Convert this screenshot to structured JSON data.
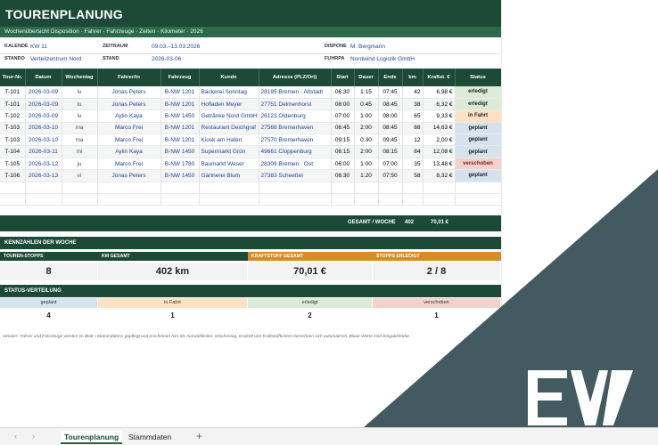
{
  "header": {
    "title": "TOURENPLANUNG",
    "subtitle": "Wochenübersicht Disposition · Fahrer · Fahrzeuge · Zeiten · Kilometer · 2026"
  },
  "meta": {
    "kalender_label": "KALENDE",
    "kalender_value": "KW 11",
    "zeitraum_label": "ZEITRAUM",
    "zeitraum_value": "09.03.–13.03.2026",
    "dispo_label": "DISPONE",
    "dispo_value": "M. Bergmann",
    "standort_label": "STANDO",
    "standort_value": "Verteilzentrum Nord",
    "stand_label": "STAND",
    "stand_value": "2026-03-06",
    "fuhrpark_label": "FUHRPA",
    "fuhrpark_value": "Nordwind Logistik GmbH"
  },
  "columns": [
    "Tour-Nr.",
    "Datum",
    "Wochentag",
    "Fahrer/in",
    "Fahrzeug",
    "Kunde",
    "Adresse (PLZ/Ort)",
    "Start",
    "Dauer",
    "Ende",
    "km",
    "Kraftst. €",
    "Status"
  ],
  "rows": [
    [
      "T-101",
      "2026-03-09",
      "lu",
      "Jonas Peters",
      "B-NW 1201",
      "Bäckerei Sonntag",
      "28195 Bremen · Altstadt",
      "06:30",
      "1:15",
      "07:45",
      "42",
      "6,98 €",
      "erledigt"
    ],
    [
      "T-101",
      "2026-03-09",
      "lu",
      "Jonas Peters",
      "B-NW 1201",
      "Hofladen Meyer",
      "27751 Delmenhorst",
      "08:00",
      "0:45",
      "08:45",
      "38",
      "6,32 €",
      "erledigt"
    ],
    [
      "T-102",
      "2026-03-09",
      "lu",
      "Aylin Kaya",
      "B-NW 1450",
      "Getränke Nord GmbH",
      "26123 Oldenburg",
      "07:00",
      "1:00",
      "08:00",
      "65",
      "9,33 €",
      "in Fahrt"
    ],
    [
      "T-103",
      "2026-03-10",
      "ma",
      "Marco Frei",
      "B-NW 1201",
      "Restaurant Deichgraf",
      "27568 Bremerhaven",
      "06:45",
      "2:00",
      "08:45",
      "88",
      "14,63 €",
      "geplant"
    ],
    [
      "T-103",
      "2026-03-10",
      "ma",
      "Marco Frei",
      "B-NW 1201",
      "Kiosk am Hafen",
      "27570 Bremerhaven",
      "09:15",
      "0:30",
      "09:45",
      "12",
      "2,00 €",
      "geplant"
    ],
    [
      "T-104",
      "2026-03-11",
      "mi",
      "Aylin Kaya",
      "B-NW 1450",
      "Supermarkt Grün",
      "49661 Cloppenburg",
      "06:15",
      "2:00",
      "08:15",
      "84",
      "12,08 €",
      "geplant"
    ],
    [
      "T-105",
      "2026-03-12",
      "ju",
      "Marco Frei",
      "B-NW 1780",
      "Baumarkt Weser",
      "28309 Bremen · Ost",
      "06:00",
      "1:00",
      "07:00",
      "35",
      "13,48 €",
      "verschoben"
    ],
    [
      "T-106",
      "2026-03-13",
      "vi",
      "Jonas Peters",
      "B-NW 1450",
      "Gärtnerei Blum",
      "27383 Scheeßel",
      "06:30",
      "1:20",
      "07:50",
      "58",
      "8,32 €",
      "geplant"
    ]
  ],
  "totals": {
    "label": "GESAMT / WOCHE",
    "km": "402",
    "fuel": "70,01 €"
  },
  "kpi": {
    "section_title": "KENNZAHLEN DER WOCHE",
    "items": [
      {
        "label": "TOUREN-STOPPS",
        "value": "8",
        "color": "#1d4a36"
      },
      {
        "label": "KM GESAMT",
        "value": "402 km",
        "color": "#1d4a36"
      },
      {
        "label": "KRAFTSTOFF GESAMT",
        "value": "70,01 €",
        "color": "#d98a2b"
      },
      {
        "label": "STOPPS ERLEDIGT",
        "value": "2 / 8",
        "color": "#d98a2b"
      }
    ]
  },
  "status_dist": {
    "section_title": "STATUS-VERTEILUNG",
    "items": [
      {
        "label": "geplant",
        "value": "4",
        "color": "#d6e3ef"
      },
      {
        "label": "in Fahrt",
        "value": "1",
        "color": "#fbe3c2"
      },
      {
        "label": "erledigt",
        "value": "2",
        "color": "#dcebd9"
      },
      {
        "label": "verschoben",
        "value": "1",
        "color": "#f4d2cc"
      }
    ]
  },
  "hint": "Hinweis: Fahrer und Fahrzeuge werden im Blatt »Stammdaten« gepflegt und erscheinen hier als Auswahllisten. Wochentag, Endzeit und Kraftstoffkosten berechnen sich automatisch. Blaue Werte sind Eingabefelder.",
  "tabs": {
    "prev": "‹",
    "next": "›",
    "active": "Tourenplanung",
    "other": "Stammdaten",
    "add": "+"
  },
  "logo_text": "EW"
}
